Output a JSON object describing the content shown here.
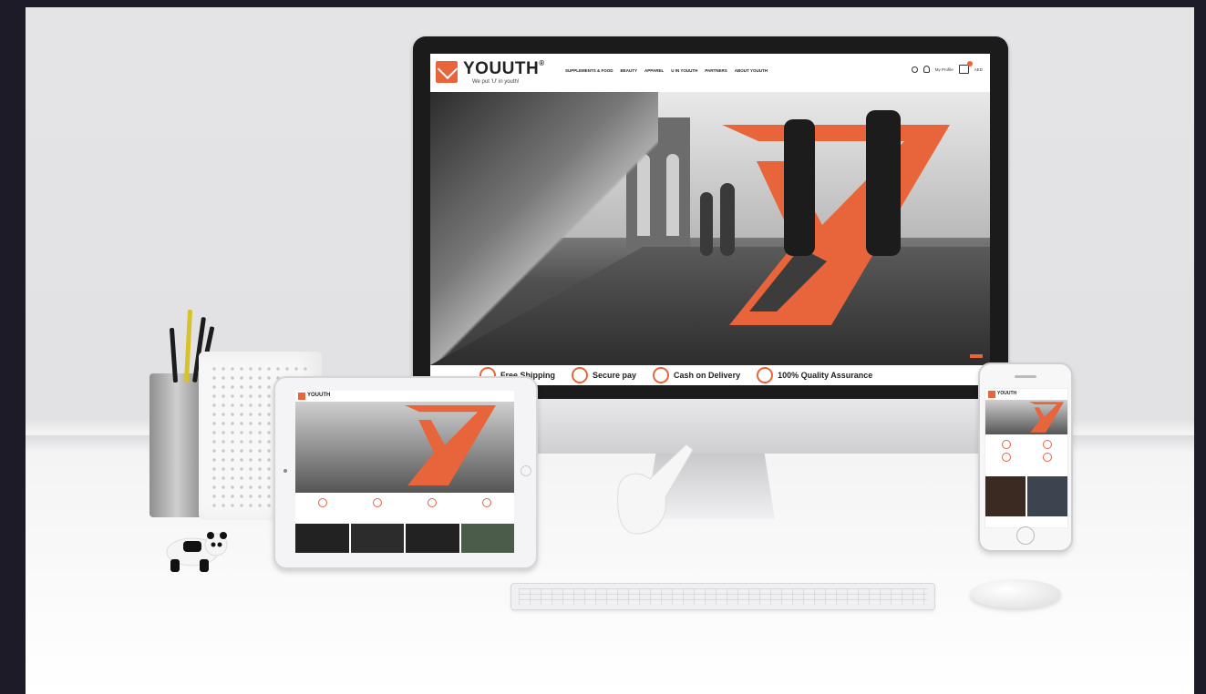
{
  "scene": "Responsive website mockup on iMac, iPad and iPhone",
  "site": {
    "brand": "YOUUTH",
    "trademark": "®",
    "tagline": "We put 'U' in youth!",
    "nav": [
      "SUPPLEMENTS & FOOD",
      "BEAUTY",
      "APPAREL",
      "U IN YOUUTH",
      "PARTNERS",
      "ABOUT YOUUTH"
    ],
    "header_right": {
      "profile": "My Profile",
      "currency": "AED"
    },
    "features": [
      "Free Shipping",
      "Secure pay",
      "Cash on Delivery",
      "100% Quality Assurance"
    ]
  },
  "colors": {
    "brand_orange": "#e8643a",
    "background": "#1d1b27",
    "wall": "#e4e4e6"
  },
  "icons": [
    "search-icon",
    "profile-icon",
    "cart-icon",
    "apple-logo-icon"
  ]
}
